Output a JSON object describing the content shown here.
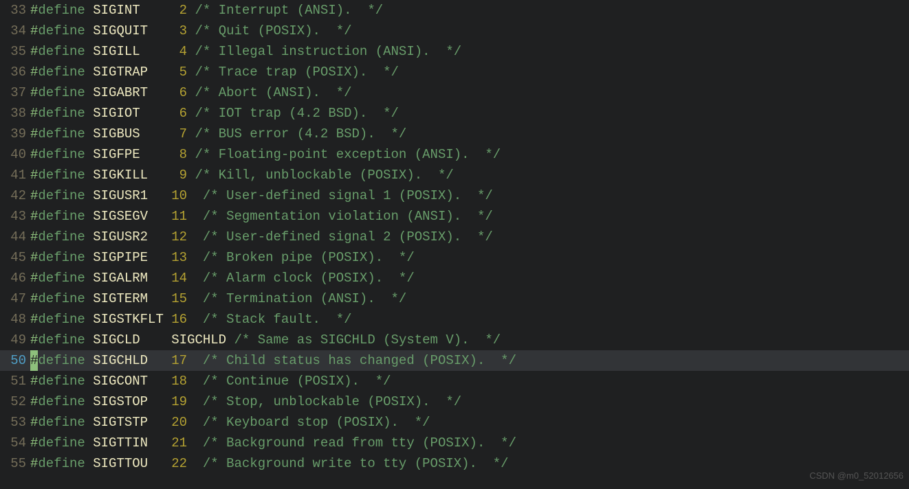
{
  "watermark": "CSDN @m0_52012656",
  "currentLine": 50,
  "defPad": 10,
  "valPad": 3,
  "commentPad": 8,
  "lines": [
    {
      "no": 33,
      "name": "SIGINT",
      "value": "2",
      "comment": "/* Interrupt (ANSI).  */"
    },
    {
      "no": 34,
      "name": "SIGQUIT",
      "value": "3",
      "comment": "/* Quit (POSIX).  */"
    },
    {
      "no": 35,
      "name": "SIGILL",
      "value": "4",
      "comment": "/* Illegal instruction (ANSI).  */"
    },
    {
      "no": 36,
      "name": "SIGTRAP",
      "value": "5",
      "comment": "/* Trace trap (POSIX).  */"
    },
    {
      "no": 37,
      "name": "SIGABRT",
      "value": "6",
      "comment": "/* Abort (ANSI).  */"
    },
    {
      "no": 38,
      "name": "SIGIOT",
      "value": "6",
      "comment": "/* IOT trap (4.2 BSD).  */"
    },
    {
      "no": 39,
      "name": "SIGBUS",
      "value": "7",
      "comment": "/* BUS error (4.2 BSD).  */"
    },
    {
      "no": 40,
      "name": "SIGFPE",
      "value": "8",
      "comment": "/* Floating-point exception (ANSI).  */"
    },
    {
      "no": 41,
      "name": "SIGKILL",
      "value": "9",
      "comment": "/* Kill, unblockable (POSIX).  */"
    },
    {
      "no": 42,
      "name": "SIGUSR1",
      "value": "10",
      "comment": "/* User-defined signal 1 (POSIX).  */"
    },
    {
      "no": 43,
      "name": "SIGSEGV",
      "value": "11",
      "comment": "/* Segmentation violation (ANSI).  */"
    },
    {
      "no": 44,
      "name": "SIGUSR2",
      "value": "12",
      "comment": "/* User-defined signal 2 (POSIX).  */"
    },
    {
      "no": 45,
      "name": "SIGPIPE",
      "value": "13",
      "comment": "/* Broken pipe (POSIX).  */"
    },
    {
      "no": 46,
      "name": "SIGALRM",
      "value": "14",
      "comment": "/* Alarm clock (POSIX).  */"
    },
    {
      "no": 47,
      "name": "SIGTERM",
      "value": "15",
      "comment": "/* Termination (ANSI).  */"
    },
    {
      "no": 48,
      "name": "SIGSTKFLT",
      "value": "16",
      "comment": "/* Stack fault.  */"
    },
    {
      "no": 49,
      "name": "SIGCLD",
      "value": "SIGCHLD",
      "comment": "/* Same as SIGCHLD (System V).  */"
    },
    {
      "no": 50,
      "name": "SIGCHLD",
      "value": "17",
      "comment": "/* Child status has changed (POSIX).  */"
    },
    {
      "no": 51,
      "name": "SIGCONT",
      "value": "18",
      "comment": "/* Continue (POSIX).  */"
    },
    {
      "no": 52,
      "name": "SIGSTOP",
      "value": "19",
      "comment": "/* Stop, unblockable (POSIX).  */"
    },
    {
      "no": 53,
      "name": "SIGTSTP",
      "value": "20",
      "comment": "/* Keyboard stop (POSIX).  */"
    },
    {
      "no": 54,
      "name": "SIGTTIN",
      "value": "21",
      "comment": "/* Background read from tty (POSIX).  */"
    },
    {
      "no": 55,
      "name": "SIGTTOU",
      "value": "22",
      "comment": "/* Background write to tty (POSIX).  */"
    }
  ]
}
